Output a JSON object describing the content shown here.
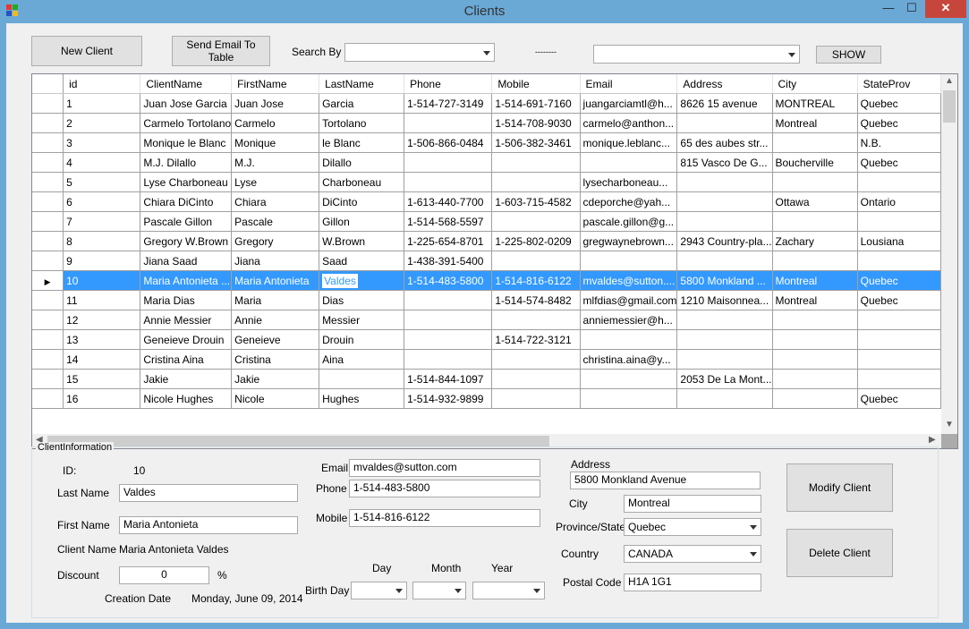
{
  "window": {
    "title": "Clients",
    "min_glyph": "—",
    "max_glyph": "☐",
    "close_glyph": "✕"
  },
  "toolbar": {
    "new_client": "New Client",
    "send_email": "Send Email To Table",
    "search_by_label": "Search By",
    "search_by_value": "",
    "separator": "--------",
    "search_value": "",
    "show": "SHOW"
  },
  "grid": {
    "columns": [
      "id",
      "ClientName",
      "FirstName",
      "LastName",
      "Phone",
      "Mobile",
      "Email",
      "Address",
      "City",
      "StateProv"
    ],
    "selected_index": 9,
    "rows": [
      [
        "1",
        "Juan Jose Garcia",
        "Juan Jose",
        "Garcia",
        "1-514-727-3149",
        "1-514-691-7160",
        "juangarciamtl@h...",
        "8626 15 avenue",
        "MONTREAL",
        "Quebec"
      ],
      [
        "2",
        "Carmelo Tortolano",
        "Carmelo",
        "Tortolano",
        "",
        "1-514-708-9030",
        "carmelo@anthon...",
        "",
        "Montreal",
        "Quebec"
      ],
      [
        "3",
        "Monique le Blanc",
        "Monique",
        "le Blanc",
        "1-506-866-0484",
        "1-506-382-3461",
        "monique.leblanc...",
        "65 des aubes str...",
        "",
        "N.B."
      ],
      [
        "4",
        "M.J. Dilallo",
        "M.J.",
        "Dilallo",
        "",
        "",
        "",
        "815 Vasco De G...",
        "Boucherville",
        "Quebec"
      ],
      [
        "5",
        "Lyse Charboneau",
        "Lyse",
        "Charboneau",
        "",
        "",
        "lysecharboneau...",
        "",
        "",
        ""
      ],
      [
        "6",
        "Chiara DiCinto",
        "Chiara",
        "DiCinto",
        "1-613-440-7700",
        "1-603-715-4582",
        "cdeporche@yah...",
        "",
        "Ottawa",
        "Ontario"
      ],
      [
        "7",
        "Pascale Gillon",
        "Pascale",
        "Gillon",
        "1-514-568-5597",
        "",
        "pascale.gillon@g...",
        "",
        "",
        ""
      ],
      [
        "8",
        "Gregory W.Brown",
        "Gregory",
        "W.Brown",
        "1-225-654-8701",
        "1-225-802-0209",
        "gregwaynebrown...",
        "2943 Country-pla...",
        "Zachary",
        "Lousiana"
      ],
      [
        "9",
        "Jiana Saad",
        "Jiana",
        "Saad",
        "1-438-391-5400",
        "",
        "",
        "",
        "",
        ""
      ],
      [
        "10",
        "Maria Antonieta ...",
        "Maria Antonieta",
        "Valdes",
        "1-514-483-5800",
        "1-514-816-6122",
        "mvaldes@sutton....",
        "5800 Monkland ...",
        "Montreal",
        "Quebec"
      ],
      [
        "11",
        "Maria Dias",
        "Maria",
        "Dias",
        "",
        "1-514-574-8482",
        "mlfdias@gmail.com",
        "1210 Maisonnea...",
        "Montreal",
        "Quebec"
      ],
      [
        "12",
        "Annie Messier",
        "Annie",
        "Messier",
        "",
        "",
        "anniemessier@h...",
        "",
        "",
        ""
      ],
      [
        "13",
        "Geneieve Drouin",
        "Geneieve",
        "Drouin",
        "",
        "1-514-722-3121",
        "",
        "",
        "",
        ""
      ],
      [
        "14",
        "Cristina Aina",
        "Cristina",
        "Aina",
        "",
        "",
        "christina.aina@y...",
        "",
        "",
        ""
      ],
      [
        "15",
        "Jakie",
        "Jakie",
        "",
        "1-514-844-1097",
        "",
        "",
        "2053 De La Mont...",
        "",
        ""
      ],
      [
        "16",
        "Nicole Hughes",
        "Nicole",
        "Hughes",
        "1-514-932-9899",
        "",
        "",
        "",
        "",
        "Quebec"
      ]
    ]
  },
  "info": {
    "group_title": "ClientInformation",
    "id_label": "ID:",
    "id_value": "10",
    "lastname_label": "Last Name",
    "lastname_value": "Valdes",
    "firstname_label": "First Name",
    "firstname_value": "Maria Antonieta",
    "clientname_label": "Client Name",
    "clientname_value": "Maria Antonieta Valdes",
    "discount_label": "Discount",
    "discount_value": "0",
    "percent": "%",
    "creation_label": "Creation Date",
    "creation_value": "Monday, June 09, 2014",
    "email_label": "Email",
    "email_value": "mvaldes@sutton.com",
    "phone_label": "Phone",
    "phone_value": "1-514-483-5800",
    "mobile_label": "Mobile",
    "mobile_value": "1-514-816-6122",
    "day_label": "Day",
    "month_label": "Month",
    "year_label": "Year",
    "birthday_label": "Birth Day",
    "address_label": "Address",
    "address_value": "5800 Monkland Avenue",
    "city_label": "City",
    "city_value": "Montreal",
    "province_label": "Province/State",
    "province_value": "Quebec",
    "country_label": "Country",
    "country_value": "CANADA",
    "postal_label": "Postal Code",
    "postal_value": "H1A 1G1",
    "modify": "Modify Client",
    "delete": "Delete Client"
  },
  "colors": {
    "frame": "#6aa8d6",
    "selection": "#3399ff",
    "close": "#c7463c"
  }
}
